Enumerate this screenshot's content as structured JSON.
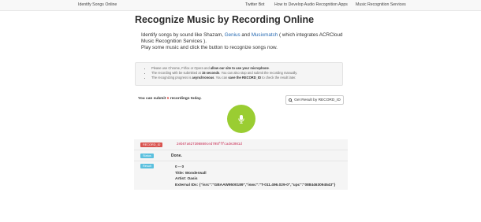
{
  "nav": {
    "brand": "Identify Songs Online",
    "links": [
      "Twitter Bot",
      "How to Develop Audio Recognition Apps",
      "Music Recognition Services"
    ]
  },
  "page": {
    "title": "Recognize Music by Recording Online",
    "intro_part1": "Identify songs by sound like Shazam, ",
    "intro_link1": "Genius",
    "intro_and": " and ",
    "intro_link2": "Musixmatch",
    "intro_part2": " ( which integrates ACRCloud Music Recognition Services ).",
    "intro_line2": "Play some music and click the button to recognize songs now."
  },
  "notice": {
    "item1_pre": "Please use Chrome, Firfox or Opera and ",
    "item1_bold": "allow our site to use your microphone",
    "item1_post": ".",
    "item2_pre": "The recording with be submitted at ",
    "item2_bold": "15 seconds",
    "item2_post": ". You can also stop and submit the recording manually.",
    "item3_pre": "The recognizing progress is ",
    "item3_bold": "asynchronous",
    "item3_mid": ". You can ",
    "item3_bold2": "save the RECORD_ID",
    "item3_post": " to check the result later."
  },
  "submit": {
    "prefix": "You can submit ",
    "count": "6",
    "suffix": " recordings today.",
    "get_result_label": "Get Result by RECORD_ID"
  },
  "result": {
    "record_label": "RECORD_ID",
    "record_id": "2eb67a627308860ced705fffcade2081d",
    "status_label": "Status",
    "status_value": "Done.",
    "result_label": "Result",
    "lines": [
      "0 -- 0",
      "Title: Wonderwall",
      "Artist: Oasis",
      "External IDs: {\"isrc\":\"GBAAW9500189\",\"iswc\":\"T-011.496.029-0\",\"upc\":\"0884463094543\"}"
    ]
  },
  "colors": {
    "mic_button": "#9acd32",
    "record_badge": "#d9534f",
    "info_badge": "#5bc0de",
    "link": "#2a6cb3"
  },
  "icons": {
    "mic": "microphone-icon",
    "search": "search-icon"
  }
}
